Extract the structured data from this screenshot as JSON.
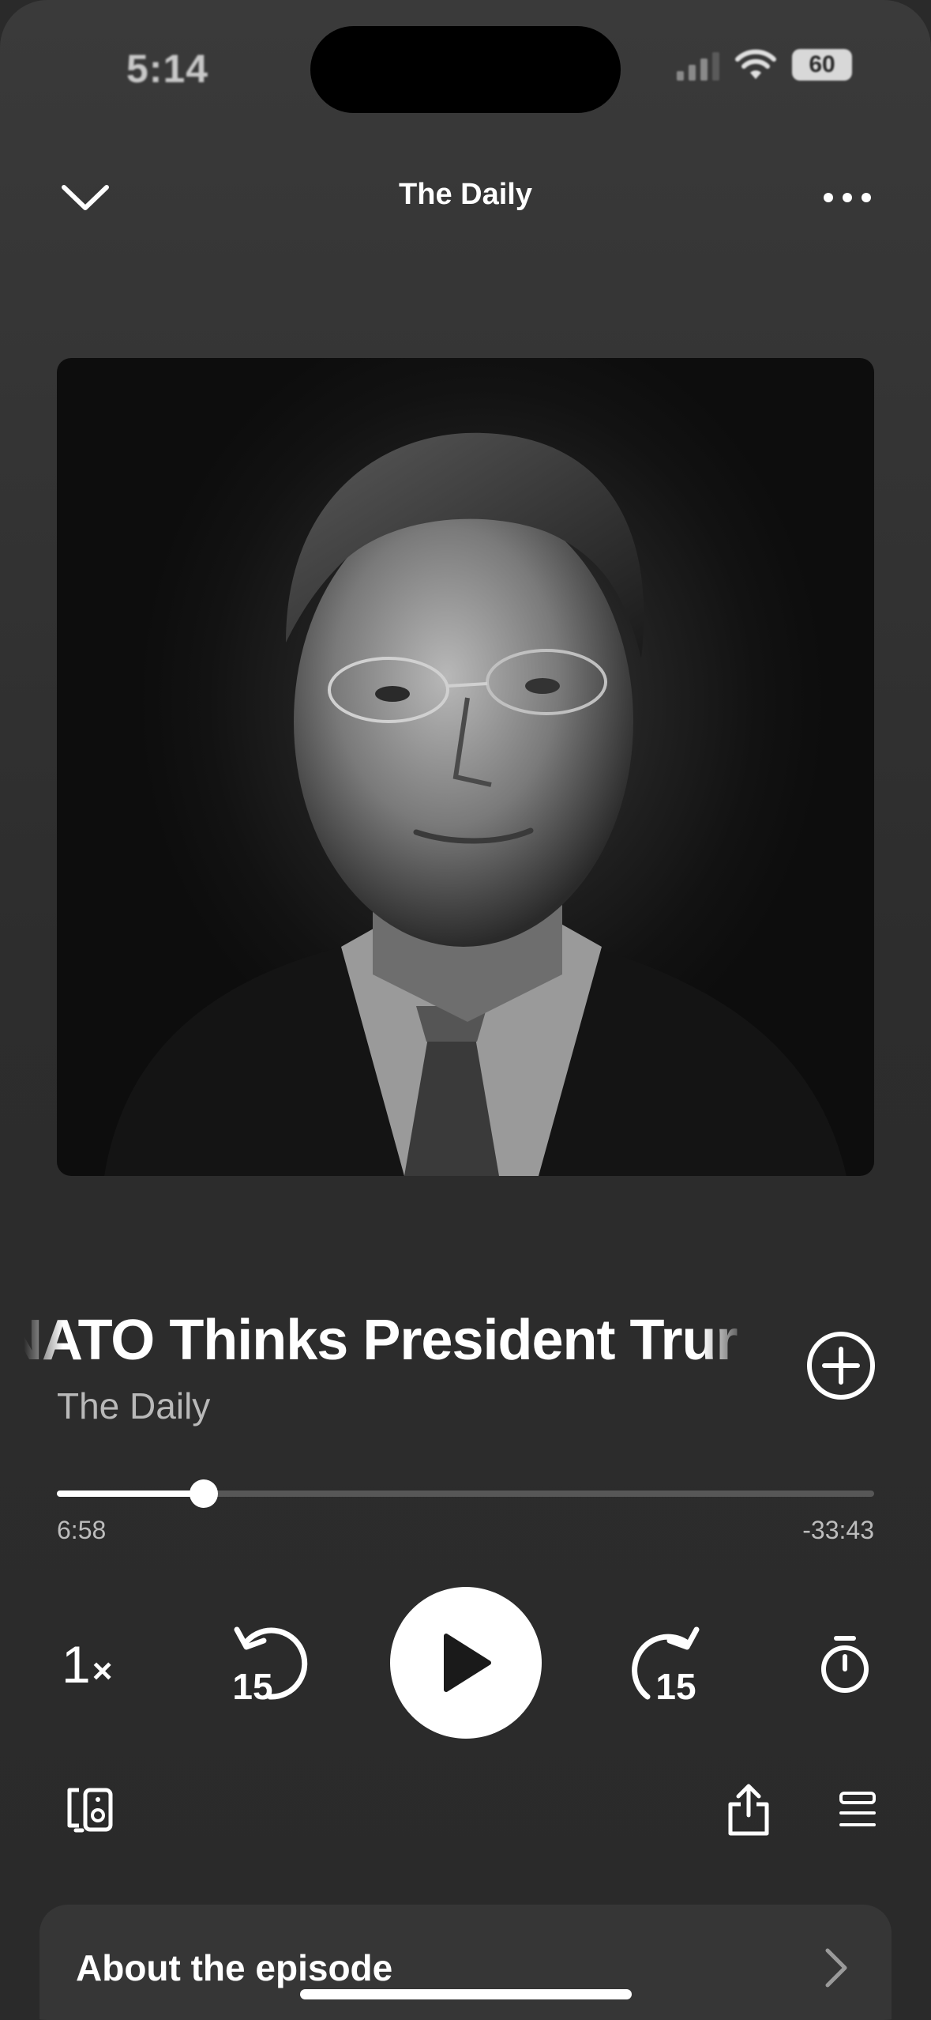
{
  "status_bar": {
    "time": "5:14",
    "battery": "60",
    "icons": [
      "cellular-signal-icon",
      "wifi-icon",
      "battery-icon"
    ]
  },
  "header": {
    "title": "The Daily",
    "left_icon": "chevron-down-icon",
    "right_icon": "more-horizontal-icon"
  },
  "episode": {
    "title": "f NATO Thinks President Trur",
    "show": "The Daily",
    "add_icon": "plus-circle-icon"
  },
  "progress": {
    "elapsed": "6:58",
    "remaining": "-33:43",
    "fraction": 0.18
  },
  "controls": {
    "speed_value": "1",
    "speed_suffix": "×",
    "skip_back_seconds": "15",
    "skip_forward_seconds": "15",
    "play_icon": "play-icon",
    "sleep_timer_icon": "timer-icon"
  },
  "bottom_actions": {
    "left_icon": "connect-device-icon",
    "share_icon": "share-icon",
    "queue_icon": "queue-icon"
  },
  "about": {
    "label": "About the episode",
    "icon": "chevron-right-icon"
  },
  "colors": {
    "background": "#2a2a2a",
    "foreground": "#ffffff",
    "muted": "#b9b9b9",
    "track": "#575757"
  }
}
